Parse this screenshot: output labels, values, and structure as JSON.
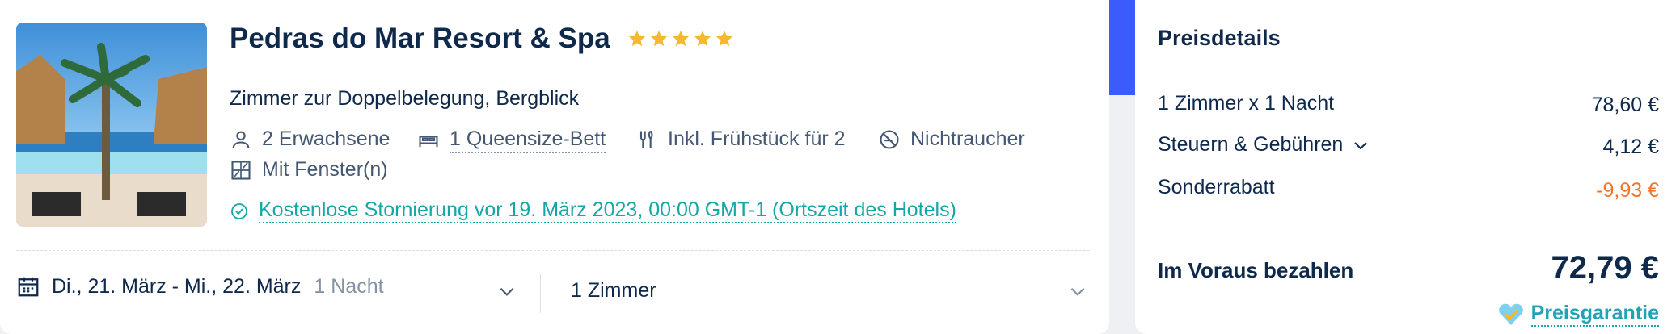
{
  "hotel": {
    "name": "Pedras do Mar Resort & Spa",
    "star_count": 5,
    "room_name": "Zimmer zur Doppelbelegung, Bergblick",
    "amenities": {
      "guests": "2 Erwachsene",
      "bed": "1 Queensize-Bett",
      "breakfast": "Inkl. Frühstück für 2",
      "smoking": "Nichtraucher",
      "window": "Mit Fenster(n)"
    },
    "cancellation": "Kostenlose Stornierung vor 19. März 2023, 00:00 GMT-1 (Ortszeit des Hotels)"
  },
  "booking": {
    "dates": "Di., 21. März - Mi., 22. März",
    "nights": "1 Nacht",
    "rooms": "1 Zimmer"
  },
  "price": {
    "title": "Preisdetails",
    "rows": [
      {
        "label": "1 Zimmer x 1 Nacht",
        "value": "78,60 €"
      },
      {
        "label": "Steuern & Gebühren",
        "value": "4,12 €"
      },
      {
        "label": "Sonderrabatt",
        "value": "-9,93 €"
      }
    ],
    "total_label": "Im Voraus bezahlen",
    "total_value": "72,79 €",
    "guarantee": "Preisgarantie"
  },
  "colors": {
    "accent": "#3b5bfb",
    "star": "#f5b82e",
    "teal": "#15a6a6",
    "discount": "#f0762a"
  }
}
